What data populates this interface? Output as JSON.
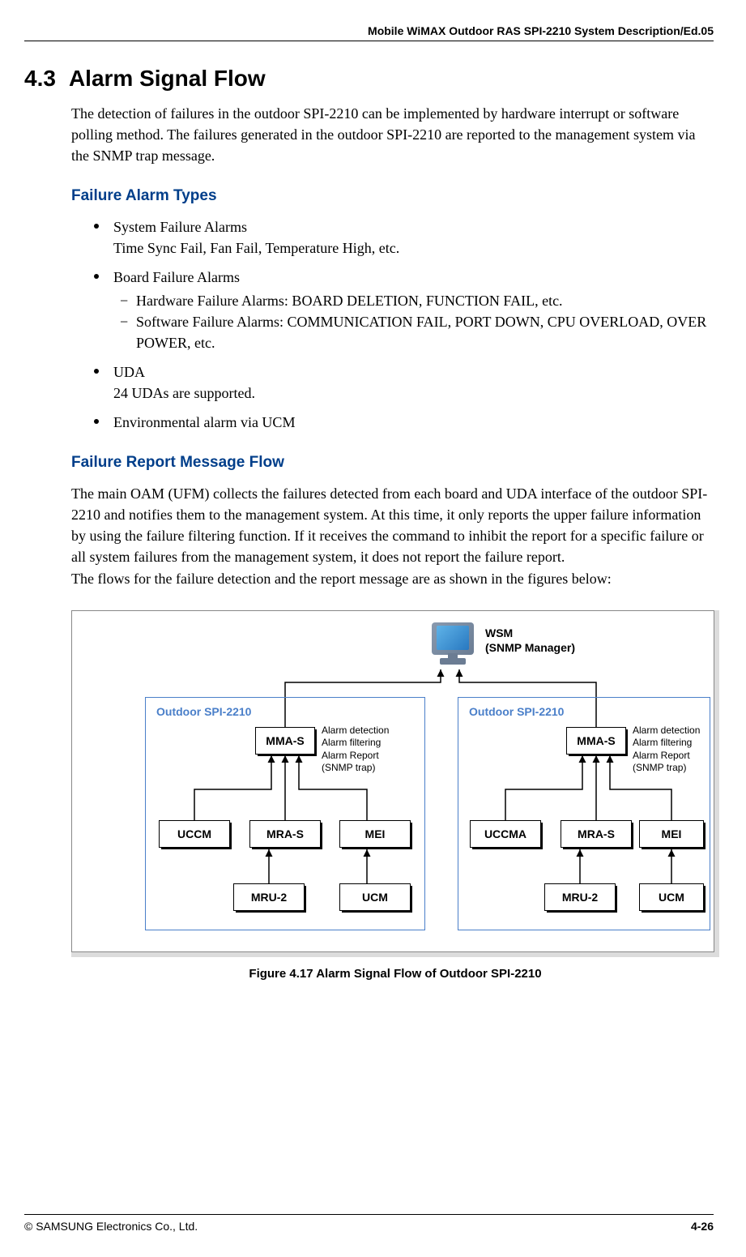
{
  "header": {
    "doc_title": "Mobile WiMAX Outdoor RAS SPI-2210 System Description/Ed.05"
  },
  "section": {
    "number": "4.3",
    "title": "Alarm Signal Flow",
    "intro": "The detection of failures in the outdoor SPI-2210 can be implemented by hardware interrupt or software polling method. The failures generated in the outdoor SPI-2210 are reported to the management system via the SNMP trap message."
  },
  "failure_types": {
    "heading": "Failure Alarm Types",
    "items": [
      {
        "title": "System Failure Alarms",
        "desc": "Time Sync Fail, Fan Fail, Temperature High, etc."
      },
      {
        "title": "Board Failure Alarms",
        "subs": [
          "Hardware Failure Alarms: BOARD DELETION, FUNCTION FAIL, etc.",
          "Software Failure Alarms: COMMUNICATION FAIL, PORT DOWN, CPU OVERLOAD, OVER POWER, etc."
        ]
      },
      {
        "title": "UDA",
        "desc": "24 UDAs are supported."
      },
      {
        "title": "Environmental alarm via UCM"
      }
    ]
  },
  "failure_report": {
    "heading": "Failure Report Message Flow",
    "body": "The main OAM (UFM) collects the failures detected from each board and UDA interface of the outdoor SPI-2210 and notifies them to the management system. At this time, it only reports the upper failure information by using the failure filtering function. If it receives the command to inhibit the report for a specific failure or all system failures from the management system, it does not report the failure report.",
    "body2": "The flows for the failure detection and the report message are as shown in the figures below:"
  },
  "diagram": {
    "wsm_line1": "WSM",
    "wsm_line2": "(SNMP Manager)",
    "spi_label": "Outdoor SPI-2210",
    "annotation_l1": "Alarm detection",
    "annotation_l2": "Alarm filtering",
    "annotation_l3": "Alarm Report",
    "annotation_l4": "(SNMP trap)",
    "boxes": {
      "mma": "MMA-S",
      "uccm": "UCCM",
      "uccma": "UCCMA",
      "mra": "MRA-S",
      "mei": "MEI",
      "mru": "MRU-2",
      "ucm": "UCM"
    }
  },
  "figure": {
    "caption": "Figure 4.17    Alarm Signal Flow of Outdoor SPI-2210"
  },
  "footer": {
    "copyright": "© SAMSUNG Electronics Co., Ltd.",
    "page": "4-26"
  }
}
